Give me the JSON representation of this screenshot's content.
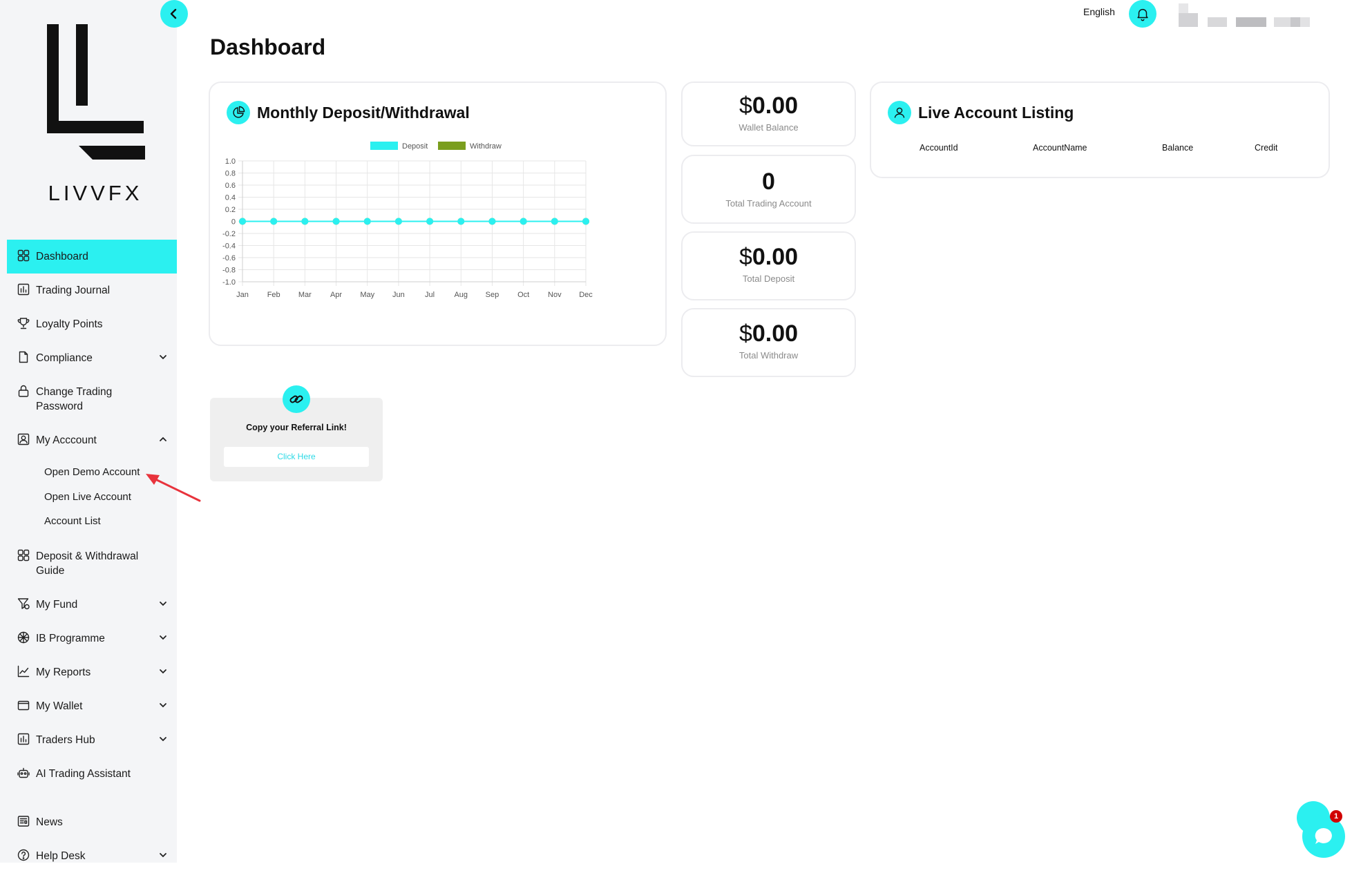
{
  "brand": {
    "logo_text": "LIVVFX"
  },
  "header": {
    "language": "English",
    "page_title": "Dashboard"
  },
  "sidebar": {
    "items": [
      {
        "label": "Dashboard",
        "icon": "grid-icon",
        "active": true
      },
      {
        "label": "Trading Journal",
        "icon": "chart-box-icon"
      },
      {
        "label": "Loyalty Points",
        "icon": "trophy-icon"
      },
      {
        "label": "Compliance",
        "icon": "document-icon",
        "expandable": true
      },
      {
        "label": "Change Trading Password",
        "icon": "lock-icon"
      },
      {
        "label": "My Acccount",
        "icon": "user-box-icon",
        "expanded": true,
        "children": [
          "Open Demo Account",
          "Open Live Account",
          "Account List"
        ]
      },
      {
        "label": "Deposit & Withdrawal Guide",
        "icon": "grid-icon"
      },
      {
        "label": "My Fund",
        "icon": "fund-icon",
        "expandable": true
      },
      {
        "label": "IB Programme",
        "icon": "network-icon",
        "expandable": true
      },
      {
        "label": "My Reports",
        "icon": "trend-icon",
        "expandable": true
      },
      {
        "label": "My Wallet",
        "icon": "wallet-icon",
        "expandable": true
      },
      {
        "label": "Traders Hub",
        "icon": "chart-box-icon",
        "expandable": true
      },
      {
        "label": "AI Trading Assistant",
        "icon": "robot-icon"
      },
      {
        "label": "News",
        "icon": "newspaper-icon"
      },
      {
        "label": "Help Desk",
        "icon": "help-icon",
        "expandable": true
      }
    ]
  },
  "chart_card": {
    "title": "Monthly Deposit/Withdrawal"
  },
  "chart_data": {
    "type": "line",
    "categories": [
      "Jan",
      "Feb",
      "Mar",
      "Apr",
      "May",
      "Jun",
      "Jul",
      "Aug",
      "Sep",
      "Oct",
      "Nov",
      "Dec"
    ],
    "series": [
      {
        "name": "Deposit",
        "color": "#2bf0f0",
        "values": [
          0,
          0,
          0,
          0,
          0,
          0,
          0,
          0,
          0,
          0,
          0,
          0
        ]
      },
      {
        "name": "Withdraw",
        "color": "#7a9e1e",
        "values": [
          0,
          0,
          0,
          0,
          0,
          0,
          0,
          0,
          0,
          0,
          0,
          0
        ]
      }
    ],
    "yticks": [
      "1.0",
      "0.8",
      "0.6",
      "0.4",
      "0.2",
      "0",
      "-0.2",
      "-0.4",
      "-0.6",
      "-0.8",
      "-1.0"
    ],
    "ylim": [
      -1,
      1
    ],
    "grid": true,
    "legend": "top-center"
  },
  "stats": [
    {
      "currency": "$",
      "value": "0.00",
      "caption": "Wallet Balance"
    },
    {
      "currency": "",
      "value": "0",
      "caption": "Total Trading Account"
    },
    {
      "currency": "$",
      "value": "0.00",
      "caption": "Total Deposit"
    },
    {
      "currency": "$",
      "value": "0.00",
      "caption": "Total Withdraw"
    }
  ],
  "live_listing": {
    "title": "Live Account Listing",
    "columns": [
      "AccountId",
      "AccountName",
      "Balance",
      "Credit"
    ]
  },
  "referral": {
    "text": "Copy your Referral Link!",
    "button": "Click Here"
  },
  "chat": {
    "badge": "1"
  },
  "colors": {
    "accent": "#2bf0f0",
    "withdraw": "#7a9e1e",
    "annotation": "#e8333c"
  }
}
